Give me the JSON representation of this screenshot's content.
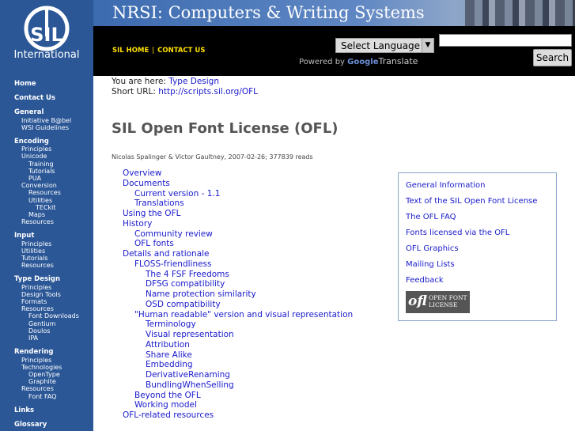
{
  "sidebar": {
    "logo_letters": "SIL",
    "logo_text": "International",
    "nav": [
      {
        "level": "top",
        "label": "Home"
      },
      {
        "level": "top",
        "label": "Contact Us"
      },
      {
        "level": "top",
        "label": "General"
      },
      {
        "level": "l1",
        "label": "Initiative B@bel"
      },
      {
        "level": "l1",
        "label": "WSI Guidelines"
      },
      {
        "level": "top",
        "label": "Encoding"
      },
      {
        "level": "l1",
        "label": "Principles"
      },
      {
        "level": "l1",
        "label": "Unicode"
      },
      {
        "level": "l2",
        "label": "Training"
      },
      {
        "level": "l2",
        "label": "Tutorials"
      },
      {
        "level": "l2",
        "label": "PUA"
      },
      {
        "level": "l1",
        "label": "Conversion"
      },
      {
        "level": "l2",
        "label": "Resources"
      },
      {
        "level": "l2",
        "label": "Utilities"
      },
      {
        "level": "l3",
        "label": "TECkit"
      },
      {
        "level": "l2",
        "label": "Maps"
      },
      {
        "level": "l1",
        "label": "Resources"
      },
      {
        "level": "top",
        "label": "Input"
      },
      {
        "level": "l1",
        "label": "Principles"
      },
      {
        "level": "l1",
        "label": "Utilities"
      },
      {
        "level": "l1",
        "label": "Tutorials"
      },
      {
        "level": "l1",
        "label": "Resources"
      },
      {
        "level": "top",
        "label": "Type Design"
      },
      {
        "level": "l1",
        "label": "Principles"
      },
      {
        "level": "l1",
        "label": "Design Tools"
      },
      {
        "level": "l1",
        "label": "Formats"
      },
      {
        "level": "l1",
        "label": "Resources"
      },
      {
        "level": "l2",
        "label": "Font Downloads"
      },
      {
        "level": "l2",
        "label": "Gentium"
      },
      {
        "level": "l2",
        "label": "Doulos"
      },
      {
        "level": "l2",
        "label": "IPA"
      },
      {
        "level": "top",
        "label": "Rendering"
      },
      {
        "level": "l1",
        "label": "Principles"
      },
      {
        "level": "l1",
        "label": "Technologies"
      },
      {
        "level": "l2",
        "label": "OpenType"
      },
      {
        "level": "l2",
        "label": "Graphite"
      },
      {
        "level": "l1",
        "label": "Resources"
      },
      {
        "level": "l2",
        "label": "Font FAQ"
      },
      {
        "level": "top",
        "label": "Links"
      },
      {
        "level": "top",
        "label": "Glossary"
      }
    ]
  },
  "header": {
    "title": "NRSI: Computers & Writing Systems",
    "links": {
      "home": "SIL HOME",
      "contact": "CONTACT US"
    },
    "language_select": "Select Language",
    "powered_by": "Powered by",
    "google": "Google",
    "translate": "Translate",
    "search_button": "Search",
    "search_value": ""
  },
  "breadcrumb": {
    "prefix": "You are here:",
    "link": "Type Design",
    "short_prefix": "Short URL:",
    "short_url": "http://scripts.sil.org/OFL"
  },
  "page": {
    "title": "SIL Open Font License (OFL)",
    "byline": "Nicolas Spalinger & Victor Gaultney, 2007-02-26; 377839 reads"
  },
  "toc": [
    {
      "depth": 0,
      "label": "Overview"
    },
    {
      "depth": 0,
      "label": "Documents"
    },
    {
      "depth": 1,
      "label": "Current version - 1.1"
    },
    {
      "depth": 1,
      "label": "Translations"
    },
    {
      "depth": 0,
      "label": "Using the OFL"
    },
    {
      "depth": 0,
      "label": "History"
    },
    {
      "depth": 1,
      "label": "Community review"
    },
    {
      "depth": 1,
      "label": "OFL fonts"
    },
    {
      "depth": 0,
      "label": "Details and rationale"
    },
    {
      "depth": 1,
      "label": "FLOSS-friendliness"
    },
    {
      "depth": 2,
      "label": "The 4 FSF Freedoms"
    },
    {
      "depth": 2,
      "label": "DFSG compatibility"
    },
    {
      "depth": 2,
      "label": "Name protection similarity"
    },
    {
      "depth": 2,
      "label": "OSD compatibility"
    },
    {
      "depth": 1,
      "label": "\"Human readable\" version and visual representation"
    },
    {
      "depth": 2,
      "label": "Terminology"
    },
    {
      "depth": 2,
      "label": "Visual representation"
    },
    {
      "depth": 2,
      "label": "Attribution"
    },
    {
      "depth": 2,
      "label": "Share Alike"
    },
    {
      "depth": 2,
      "label": "Embedding"
    },
    {
      "depth": 2,
      "label": "DerivativeRenaming"
    },
    {
      "depth": 2,
      "label": "BundlingWhenSelling"
    },
    {
      "depth": 1,
      "label": "Beyond the OFL"
    },
    {
      "depth": 1,
      "label": "Working model"
    },
    {
      "depth": 0,
      "label": "OFL-related resources"
    }
  ],
  "rightbox": {
    "links": [
      "General Information",
      "Text of the SIL Open Font License",
      "The OFL FAQ",
      "Fonts licensed via the OFL",
      "OFL Graphics",
      "Mailing Lists",
      "Feedback"
    ],
    "badge_mark": "ofl",
    "badge_line1": "OPEN FONT",
    "badge_line2": "LICENSE"
  }
}
